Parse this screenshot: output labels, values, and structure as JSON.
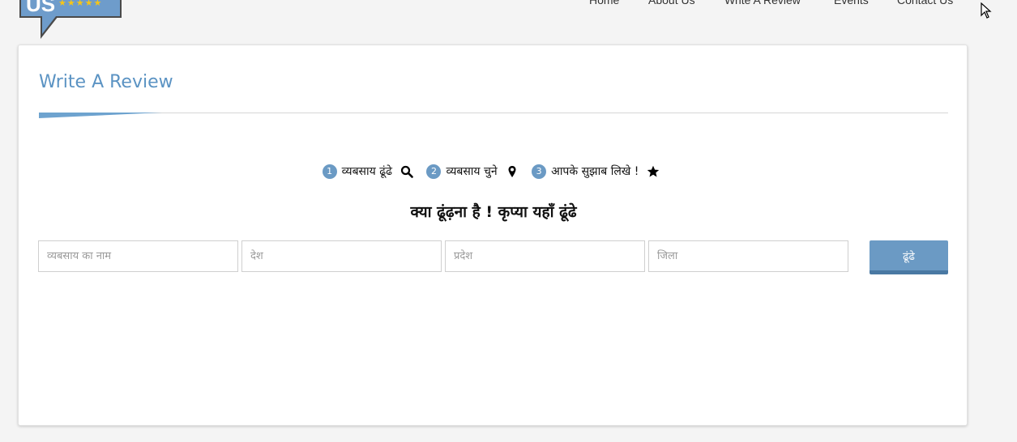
{
  "logo": {
    "text": "US",
    "stars": "★★★★★"
  },
  "nav": {
    "items": [
      "Home",
      "About Us",
      "Write A Review",
      "Events",
      "Contact Us"
    ]
  },
  "page": {
    "title": "Write A Review"
  },
  "steps": [
    {
      "number": "1",
      "label": "व्यबसाय ढूंढे",
      "icon": "search-icon"
    },
    {
      "number": "2",
      "label": "व्यबसाय चुने",
      "icon": "map-marker-icon"
    },
    {
      "number": "3",
      "label": "आपके सुझाब लिखे !",
      "icon": "star-icon"
    }
  ],
  "search": {
    "prompt": "क्या ढूंढ़ना है ! कृप्या यहाँ ढूंढे",
    "business_placeholder": "व्यबसाय का नाम",
    "country_placeholder": "देश",
    "state_placeholder": "प्रदेश",
    "district_placeholder": "जिला",
    "business_value": "",
    "country_value": "",
    "state_value": "",
    "district_value": "",
    "button_label": "ढूंढे"
  },
  "colors": {
    "accent": "#5b93c3",
    "button": "#6b9ac4",
    "button_shadow": "#4a79a3",
    "logo_background": "#6e9ccb",
    "stars": "#f5c518",
    "page_background": "#f4f4f4"
  }
}
